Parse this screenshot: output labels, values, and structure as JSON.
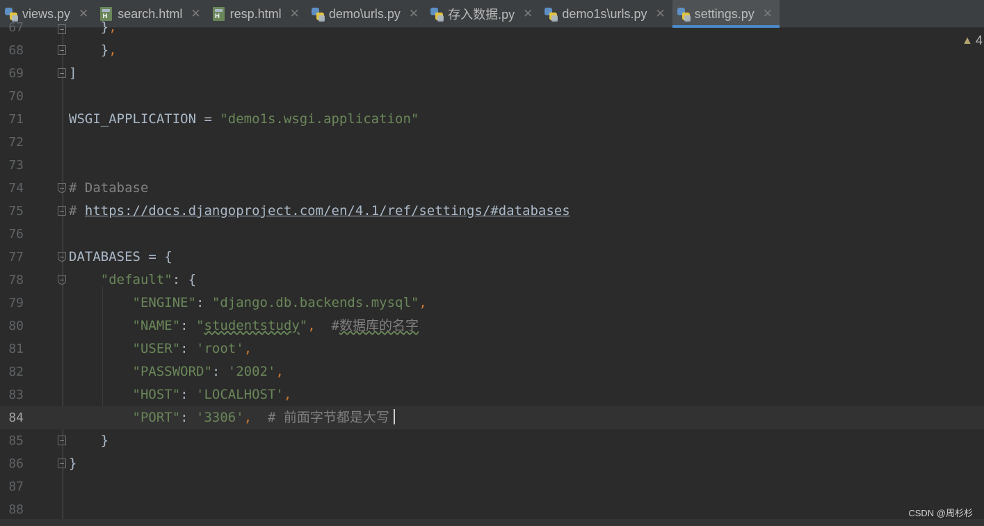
{
  "tabs": [
    {
      "label": "views.py",
      "icon": "python-file-icon",
      "active": false
    },
    {
      "label": "search.html",
      "icon": "html-file-icon",
      "active": false
    },
    {
      "label": "resp.html",
      "icon": "html-file-icon",
      "active": false
    },
    {
      "label": "demo\\urls.py",
      "icon": "python-file-icon",
      "active": false
    },
    {
      "label": "存入数据.py",
      "icon": "python-file-icon",
      "active": false
    },
    {
      "label": "demo1s\\urls.py",
      "icon": "python-file-icon",
      "active": false
    },
    {
      "label": "settings.py",
      "icon": "python-file-icon",
      "active": true
    }
  ],
  "tab_close_glyph": "✕",
  "inspection": {
    "icon": "warning-triangle-icon",
    "count": "4"
  },
  "editor": {
    "current_line": "84",
    "lines": [
      {
        "num": "67",
        "code": "    },"
      },
      {
        "num": "68",
        "code": "    },"
      },
      {
        "num": "69",
        "code": "]"
      },
      {
        "num": "70",
        "code": ""
      },
      {
        "num": "71",
        "code": "WSGI_APPLICATION = \"demo1s.wsgi.application\""
      },
      {
        "num": "72",
        "code": ""
      },
      {
        "num": "73",
        "code": ""
      },
      {
        "num": "74",
        "code": "# Database"
      },
      {
        "num": "75",
        "code": "# https://docs.djangoproject.com/en/4.1/ref/settings/#databases"
      },
      {
        "num": "76",
        "code": ""
      },
      {
        "num": "77",
        "code": "DATABASES = {"
      },
      {
        "num": "78",
        "code": "    \"default\": {"
      },
      {
        "num": "79",
        "code": "        \"ENGINE\": \"django.db.backends.mysql\","
      },
      {
        "num": "80",
        "code": "        \"NAME\": \"studentstudy\",  #数据库的名字"
      },
      {
        "num": "81",
        "code": "        \"USER\": 'root',"
      },
      {
        "num": "82",
        "code": "        \"PASSWORD\": '2002',"
      },
      {
        "num": "83",
        "code": "        \"HOST\": 'LOCALHOST',"
      },
      {
        "num": "84",
        "code": "        \"PORT\": '3306',  # 前面字节都是大写"
      },
      {
        "num": "85",
        "code": "    }"
      },
      {
        "num": "86",
        "code": "}"
      },
      {
        "num": "87",
        "code": ""
      },
      {
        "num": "88",
        "code": ""
      }
    ]
  },
  "watermark": "CSDN @周杉杉",
  "colors": {
    "background": "#2b2b2b",
    "tabbar": "#3c3f41",
    "active_tab_underline": "#4a88c7",
    "string": "#6a8759",
    "punctuation": "#cc7832",
    "comment": "#808080",
    "identifier": "#a9b7c6",
    "line_number": "#606366"
  }
}
